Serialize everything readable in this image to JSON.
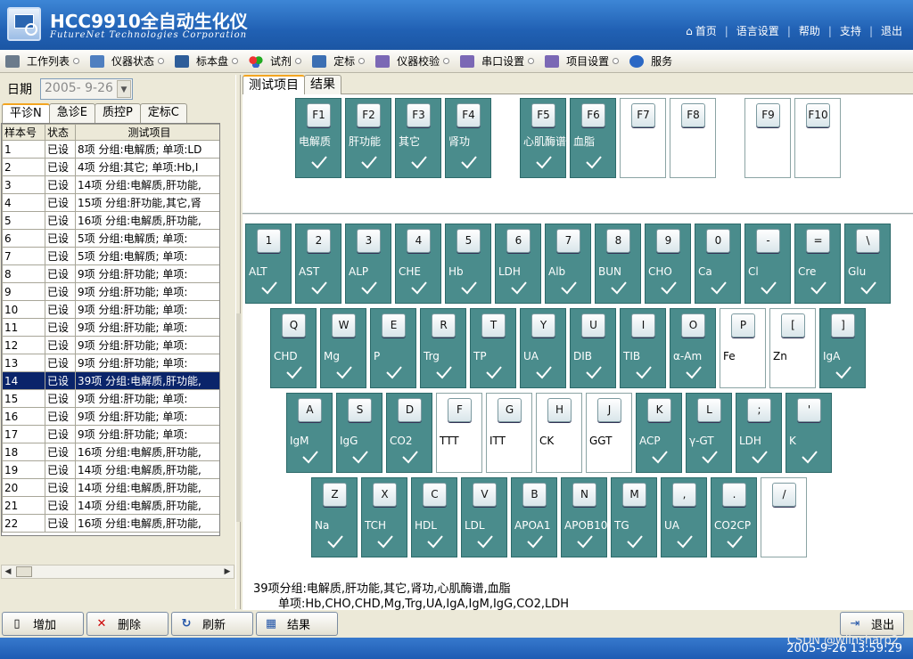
{
  "header": {
    "title": "HCC9910全自动生化仪",
    "subtitle": "FutureNet Technologies Corporation",
    "nav": [
      "首页",
      "语言设置",
      "帮助",
      "支持",
      "退出"
    ]
  },
  "toolbar": [
    "工作列表",
    "仪器状态",
    "标本盘",
    "试剂",
    "定标",
    "仪器校验",
    "串口设置",
    "项目设置",
    "服务"
  ],
  "date": {
    "label": "日期",
    "value": "2005- 9-26"
  },
  "left_tabs": [
    "平诊N",
    "急诊E",
    "质控P",
    "定标C"
  ],
  "sample_table": {
    "headers": [
      "样本号",
      "状态",
      "测试项目"
    ],
    "rows": [
      [
        "1",
        "已设",
        "8项 分组:电解质; 单项:LD"
      ],
      [
        "2",
        "已设",
        "4项 分组:其它; 单项:Hb,I"
      ],
      [
        "3",
        "已设",
        "14项 分组:电解质,肝功能,"
      ],
      [
        "4",
        "已设",
        "15项 分组:肝功能,其它,肾"
      ],
      [
        "5",
        "已设",
        "16项 分组:电解质,肝功能,"
      ],
      [
        "6",
        "已设",
        "5项 分组:电解质; 单项:"
      ],
      [
        "7",
        "已设",
        "5项 分组:电解质; 单项:"
      ],
      [
        "8",
        "已设",
        "9项 分组:肝功能; 单项:"
      ],
      [
        "9",
        "已设",
        "9项 分组:肝功能; 单项:"
      ],
      [
        "10",
        "已设",
        "9项 分组:肝功能; 单项:"
      ],
      [
        "11",
        "已设",
        "9项 分组:肝功能; 单项:"
      ],
      [
        "12",
        "已设",
        "9项 分组:肝功能; 单项:"
      ],
      [
        "13",
        "已设",
        "9项 分组:肝功能; 单项:"
      ],
      [
        "14",
        "已设",
        "39项 分组:电解质,肝功能,"
      ],
      [
        "15",
        "已设",
        "9项 分组:肝功能; 单项:"
      ],
      [
        "16",
        "已设",
        "9项 分组:肝功能; 单项:"
      ],
      [
        "17",
        "已设",
        "9项 分组:肝功能; 单项:"
      ],
      [
        "18",
        "已设",
        "16项 分组:电解质,肝功能,"
      ],
      [
        "19",
        "已设",
        "14项 分组:电解质,肝功能,"
      ],
      [
        "20",
        "已设",
        "14项 分组:电解质,肝功能,"
      ],
      [
        "21",
        "已设",
        "14项 分组:电解质,肝功能,"
      ],
      [
        "22",
        "已设",
        "16项 分组:电解质,肝功能,"
      ]
    ],
    "selected_row": "14"
  },
  "right_tabs": [
    "测试项目",
    "结果"
  ],
  "fkeys": [
    {
      "cap": "F1",
      "label": "电解质",
      "on": true
    },
    {
      "cap": "F2",
      "label": "肝功能",
      "on": true
    },
    {
      "cap": "F3",
      "label": "其它",
      "on": true
    },
    {
      "cap": "F4",
      "label": "肾功",
      "on": true
    },
    {
      "cap": "F5",
      "label": "心肌酶谱",
      "on": true
    },
    {
      "cap": "F6",
      "label": "血脂",
      "on": true
    },
    {
      "cap": "F7",
      "label": "",
      "on": false
    },
    {
      "cap": "F8",
      "label": "",
      "on": false
    },
    {
      "cap": "F9",
      "label": "",
      "on": false
    },
    {
      "cap": "F10",
      "label": "",
      "on": false
    }
  ],
  "key_rows": [
    [
      {
        "cap": "1",
        "label": "ALT",
        "on": true
      },
      {
        "cap": "2",
        "label": "AST",
        "on": true
      },
      {
        "cap": "3",
        "label": "ALP",
        "on": true
      },
      {
        "cap": "4",
        "label": "CHE",
        "on": true
      },
      {
        "cap": "5",
        "label": "Hb",
        "on": true
      },
      {
        "cap": "6",
        "label": "LDH",
        "on": true
      },
      {
        "cap": "7",
        "label": "Alb",
        "on": true
      },
      {
        "cap": "8",
        "label": "BUN",
        "on": true
      },
      {
        "cap": "9",
        "label": "CHO",
        "on": true
      },
      {
        "cap": "0",
        "label": "Ca",
        "on": true
      },
      {
        "cap": "-",
        "label": "Cl",
        "on": true
      },
      {
        "cap": "=",
        "label": "Cre",
        "on": true
      },
      {
        "cap": "\\",
        "label": "Glu",
        "on": true
      }
    ],
    [
      {
        "cap": "Q",
        "label": "CHD",
        "on": true
      },
      {
        "cap": "W",
        "label": "Mg",
        "on": true
      },
      {
        "cap": "E",
        "label": "P",
        "on": true
      },
      {
        "cap": "R",
        "label": "Trg",
        "on": true
      },
      {
        "cap": "T",
        "label": "TP",
        "on": true
      },
      {
        "cap": "Y",
        "label": "UA",
        "on": true
      },
      {
        "cap": "U",
        "label": "DIB",
        "on": true
      },
      {
        "cap": "I",
        "label": "TIB",
        "on": true
      },
      {
        "cap": "O",
        "label": "α-Am",
        "on": true
      },
      {
        "cap": "P",
        "label": "Fe",
        "on": false
      },
      {
        "cap": "[",
        "label": "Zn",
        "on": false
      },
      {
        "cap": "]",
        "label": "IgA",
        "on": true
      }
    ],
    [
      {
        "cap": "A",
        "label": "IgM",
        "on": true
      },
      {
        "cap": "S",
        "label": "IgG",
        "on": true
      },
      {
        "cap": "D",
        "label": "CO2",
        "on": true
      },
      {
        "cap": "F",
        "label": "TTT",
        "on": false
      },
      {
        "cap": "G",
        "label": "ITT",
        "on": false
      },
      {
        "cap": "H",
        "label": "CK",
        "on": false
      },
      {
        "cap": "J",
        "label": "GGT",
        "on": false
      },
      {
        "cap": "K",
        "label": "ACP",
        "on": true
      },
      {
        "cap": "L",
        "label": "γ-GT",
        "on": true
      },
      {
        "cap": ";",
        "label": "LDH",
        "on": true
      },
      {
        "cap": "'",
        "label": "K",
        "on": true
      }
    ],
    [
      {
        "cap": "Z",
        "label": "Na",
        "on": true
      },
      {
        "cap": "X",
        "label": "TCH",
        "on": true
      },
      {
        "cap": "C",
        "label": "HDL",
        "on": true
      },
      {
        "cap": "V",
        "label": "LDL",
        "on": true
      },
      {
        "cap": "B",
        "label": "APOA1",
        "on": true
      },
      {
        "cap": "N",
        "label": "APOB10",
        "on": true
      },
      {
        "cap": "M",
        "label": "TG",
        "on": true
      },
      {
        "cap": ",",
        "label": "UA",
        "on": true
      },
      {
        "cap": ".",
        "label": "CO2CP",
        "on": true
      },
      {
        "cap": "/",
        "label": "",
        "on": false
      }
    ]
  ],
  "summary": {
    "line1": "39项分组:电解质,肝功能,其它,肾功,心肌酶谱,血脂",
    "line2": "单项:Hb,CHO,CHD,Mg,Trg,UA,IgA,IgM,IgG,CO2,LDH"
  },
  "buttons": {
    "add": "增加",
    "delete": "删除",
    "refresh": "刷新",
    "result": "结果",
    "exit": "退出"
  },
  "status": {
    "clock": "2005-9-26 13:59:29",
    "watermark": "CSDN @wilnsharp2"
  },
  "colors": {
    "key_on": "#4a8c8c",
    "header_blue": "#2161b4"
  }
}
